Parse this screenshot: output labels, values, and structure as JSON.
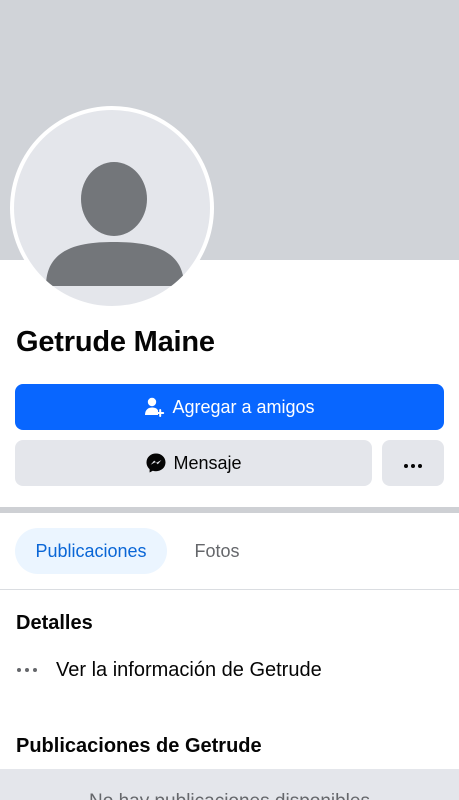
{
  "profile": {
    "name": "Getrude Maine"
  },
  "actions": {
    "add_friend_label": "Agregar a amigos",
    "add_friend_icon": "add-person-icon",
    "message_label": "Mensaje",
    "message_icon": "messenger-icon",
    "more_icon": "more-dots-icon"
  },
  "tabs": [
    {
      "label": "Publicaciones",
      "active": true
    },
    {
      "label": "Fotos",
      "active": false
    }
  ],
  "details": {
    "title": "Detalles",
    "info_label": "Ver la información de Getrude",
    "info_icon": "more-dots-icon"
  },
  "posts": {
    "title": "Publicaciones de Getrude",
    "empty_text": "No hay publicaciones disponibles"
  },
  "colors": {
    "accent": "#0866ff",
    "tab_active_bg": "#ebf5ff",
    "tab_active_text": "#0a66d6",
    "cover": "#d0d3d8",
    "secondary_button": "#e4e6eb"
  }
}
